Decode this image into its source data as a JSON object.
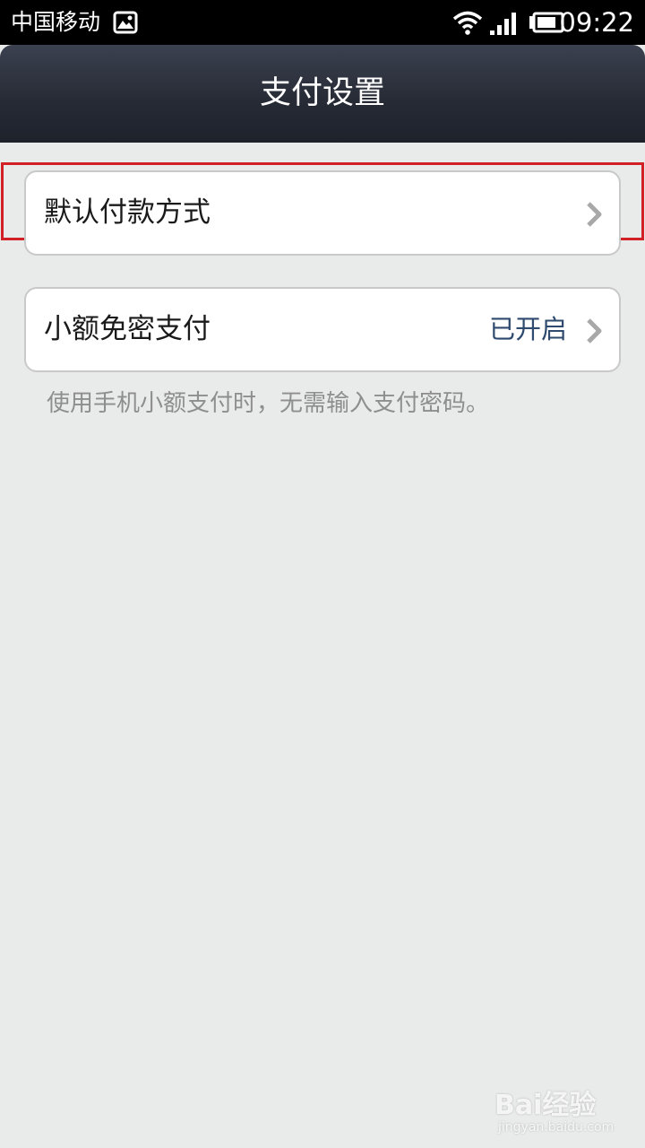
{
  "status_bar": {
    "carrier": "中国移动",
    "time": "09:22",
    "icons": [
      "gallery-icon",
      "wifi-icon",
      "signal-icon",
      "battery-icon"
    ]
  },
  "header": {
    "title": "支付设置"
  },
  "settings": {
    "items": [
      {
        "label": "默认付款方式",
        "value": "",
        "icon": "chevron-right-icon",
        "highlighted": true
      },
      {
        "label": "小额免密支付",
        "value": "已开启",
        "icon": "chevron-right-icon",
        "highlighted": false
      }
    ],
    "hint": "使用手机小额支付时，无需输入支付密码。"
  },
  "watermark": {
    "logo": "Bai经验",
    "sub": "jingyan.baidu.com"
  },
  "colors": {
    "background": "#e9eaea",
    "header_top": "#3c4150",
    "header_bottom": "#1e222b",
    "highlight": "#d12127",
    "value_text": "#2e4a6e",
    "hint_text": "#8e8e8e"
  }
}
